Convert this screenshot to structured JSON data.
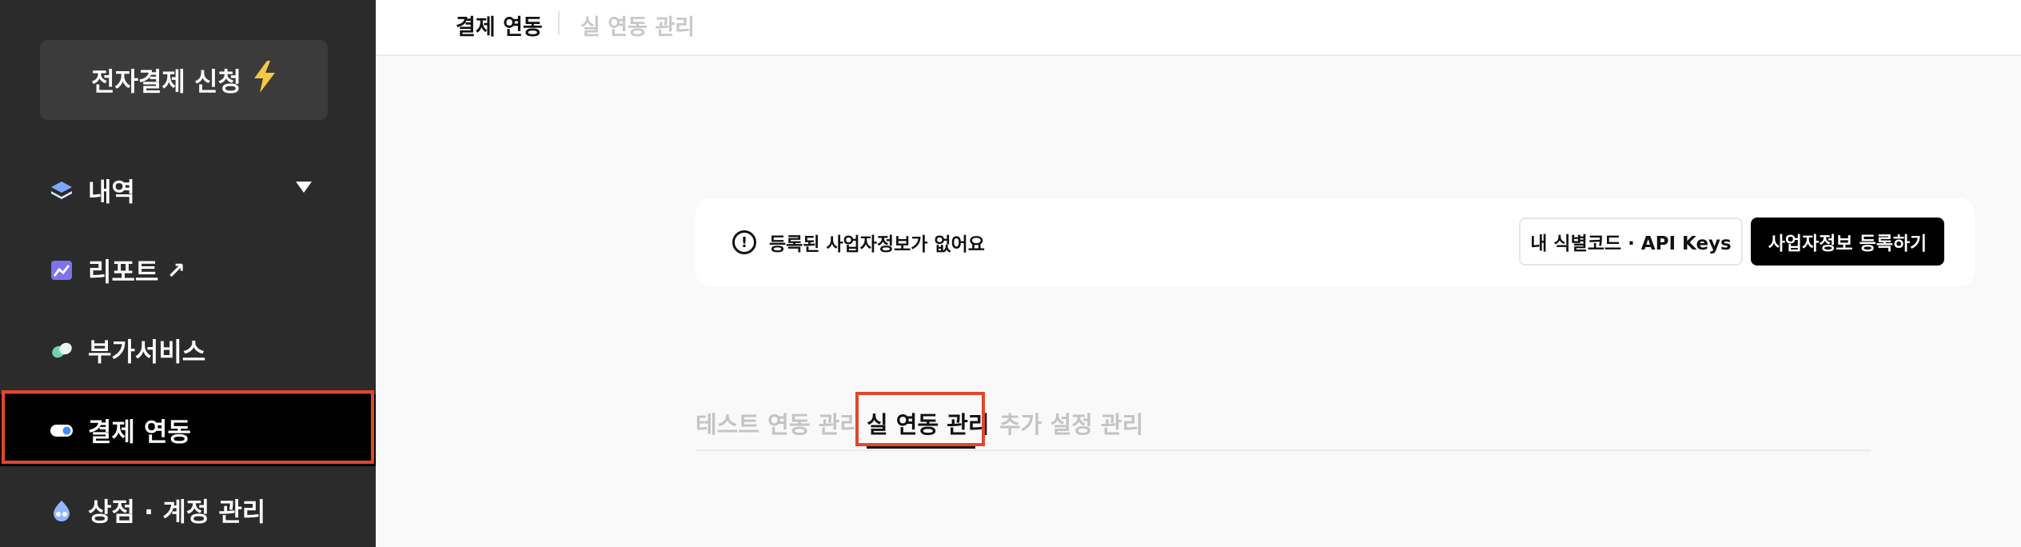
{
  "sidebar": {
    "apply_button": {
      "label": "전자결제 신청",
      "icon": "lightning-icon"
    },
    "items": [
      {
        "label": "내역",
        "icon": "layers-icon",
        "suffix": "dropdown"
      },
      {
        "label": "리포트",
        "icon": "chart-icon",
        "suffix": "↗"
      },
      {
        "label": "부가서비스",
        "icon": "addon-icon"
      },
      {
        "label": "결제 연동",
        "icon": "toggle-icon",
        "active": true
      },
      {
        "label": "상점 · 계정 관리",
        "icon": "store-icon"
      }
    ]
  },
  "breadcrumb": {
    "current": "결제 연동",
    "next": "실 연동 관리"
  },
  "notice": {
    "text": "등록된 사업자정보가 없어요",
    "secondary_button": "내 식별코드 · API Keys",
    "primary_button": "사업자정보 등록하기"
  },
  "tabs": [
    {
      "label": "테스트 연동 관리",
      "active": false
    },
    {
      "label": "실 연동 관리",
      "active": true
    },
    {
      "label": "추가 설정 관리",
      "active": false
    }
  ],
  "colors": {
    "sidebar_bg": "#2b2b2b",
    "active_bg": "#000000",
    "highlight": "#e2462c",
    "lightning": "#f5c842"
  }
}
